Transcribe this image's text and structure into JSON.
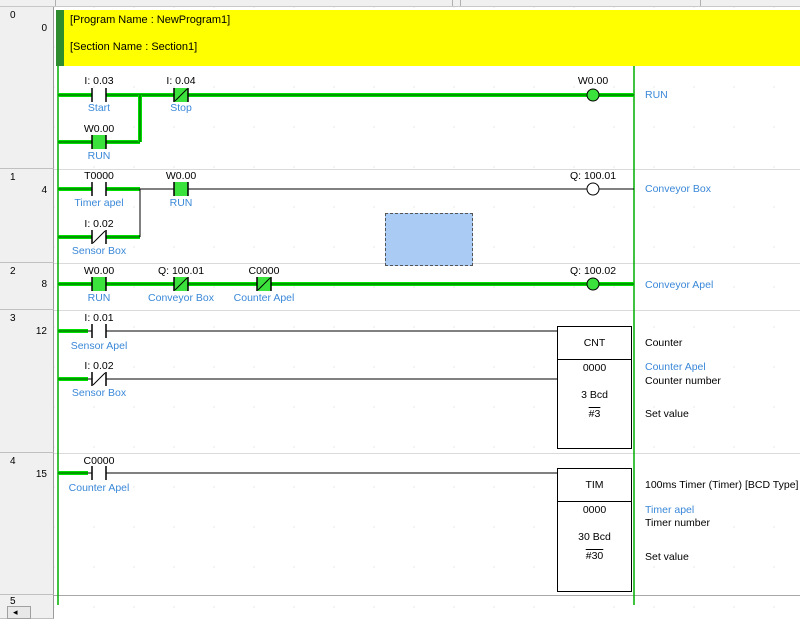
{
  "section": {
    "program_name": "[Program Name : NewProgram1]",
    "section_name": "[Section Name : Section1]",
    "header_index": "0",
    "header_step": "0"
  },
  "rungs": [
    {
      "index": "0",
      "step": "",
      "contacts": [
        {
          "address": "I: 0.03",
          "comment": "Start",
          "kind": "NO"
        },
        {
          "address": "I: 0.04",
          "comment": "Stop",
          "kind": "NC"
        },
        {
          "address": "W0.00",
          "comment": "RUN",
          "kind": "NO"
        }
      ],
      "coil": {
        "address": "W0.00",
        "comment": "RUN"
      }
    },
    {
      "index": "1",
      "step": "4",
      "contacts": [
        {
          "address": "T0000",
          "comment": "Timer apel",
          "kind": "NO"
        },
        {
          "address": "W0.00",
          "comment": "RUN",
          "kind": "NO"
        },
        {
          "address": "I: 0.02",
          "comment": "Sensor Box",
          "kind": "NC"
        }
      ],
      "coil": {
        "address": "Q: 100.01",
        "comment": "Conveyor Box"
      }
    },
    {
      "index": "2",
      "step": "8",
      "contacts": [
        {
          "address": "W0.00",
          "comment": "RUN",
          "kind": "NO"
        },
        {
          "address": "Q: 100.01",
          "comment": "Conveyor Box",
          "kind": "NC"
        },
        {
          "address": "C0000",
          "comment": "Counter Apel",
          "kind": "NC"
        }
      ],
      "coil": {
        "address": "Q: 100.02",
        "comment": "Conveyor Apel"
      }
    },
    {
      "index": "3",
      "step": "12",
      "contacts": [
        {
          "address": "I: 0.01",
          "comment": "Sensor Apel",
          "kind": "NO"
        },
        {
          "address": "I: 0.02",
          "comment": "Sensor Box",
          "kind": "NC"
        }
      ],
      "block": {
        "name": "CNT",
        "operand": "0000",
        "set_value": "3 Bcd",
        "set_const": "#3",
        "desc": "Counter",
        "operand_comment": "Counter Apel",
        "operand_desc": "Counter number",
        "set_desc": "Set value"
      }
    },
    {
      "index": "4",
      "step": "15",
      "contacts": [
        {
          "address": "C0000",
          "comment": "Counter Apel",
          "kind": "NO"
        }
      ],
      "block": {
        "name": "TIM",
        "operand": "0000",
        "set_value": "30 Bcd",
        "set_const": "#30",
        "desc": "100ms Timer (Timer) [BCD Type]",
        "operand_comment": "Timer apel",
        "operand_desc": "Timer number",
        "set_desc": "Set value"
      }
    },
    {
      "index": "5",
      "step": ""
    }
  ],
  "scrollbar": {
    "left_arrow": "◂"
  },
  "colors": {
    "active_wire": "#00c000",
    "header_bg": "#ffff00",
    "comment_blue": "#3a88d8",
    "selection": "#a9cbf4"
  }
}
